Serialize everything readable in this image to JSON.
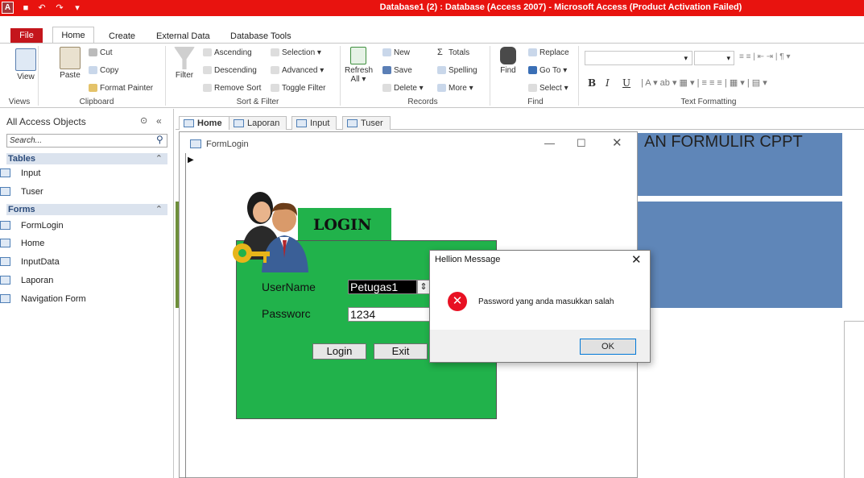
{
  "window": {
    "title": "Database1 (2) : Database (Access 2007)  -  Microsoft Access (Product Activation Failed)"
  },
  "ribbon": {
    "tabs": [
      "File",
      "Home",
      "Create",
      "External Data",
      "Database Tools"
    ],
    "views": {
      "view_label": "View",
      "group": "Views"
    },
    "clipboard": {
      "paste": "Paste",
      "cut": "Cut",
      "copy": "Copy",
      "format_painter": "Format Painter",
      "group": "Clipboard"
    },
    "sort_filter": {
      "filter": "Filter",
      "ascending": "Ascending",
      "descending": "Descending",
      "remove_sort": "Remove Sort",
      "selection": "Selection",
      "advanced": "Advanced",
      "toggle_filter": "Toggle Filter",
      "group": "Sort & Filter"
    },
    "records": {
      "refresh": "Refresh",
      "refresh2": "All",
      "new": "New",
      "save": "Save",
      "delete": "Delete",
      "totals": "Totals",
      "spelling": "Spelling",
      "more": "More",
      "group": "Records"
    },
    "find": {
      "find": "Find",
      "replace": "Replace",
      "goto": "Go To",
      "select": "Select",
      "group": "Find"
    },
    "text_formatting": {
      "group": "Text Formatting"
    }
  },
  "nav": {
    "header": "All Access Objects",
    "search_placeholder": "Search...",
    "tables_label": "Tables",
    "tables": [
      "Input",
      "Tuser"
    ],
    "forms_label": "Forms",
    "forms": [
      "FormLogin",
      "Home",
      "InputData",
      "Laporan",
      "Navigation Form"
    ]
  },
  "doc_tabs": [
    "Home",
    "Laporan",
    "Input",
    "Tuser"
  ],
  "background": {
    "heading": "AN FORMULIR CPPT"
  },
  "form": {
    "title": "FormLogin",
    "heading": "LOGIN",
    "username_label": "UserName",
    "username_value": "Petugas1",
    "password_label": "Passworc",
    "password_value": "1234",
    "login_button": "Login",
    "exit_button": "Exit"
  },
  "dialog": {
    "title": "Hellion Message",
    "message": "Password yang anda masukkan salah",
    "ok": "OK"
  }
}
